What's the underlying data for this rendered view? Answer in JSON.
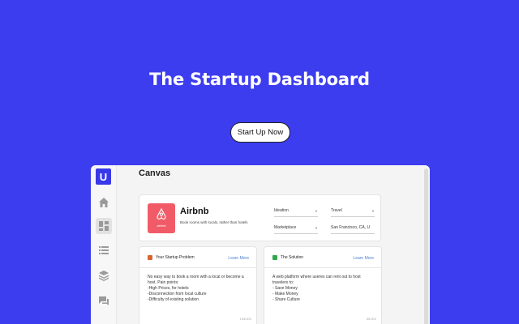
{
  "hero": {
    "title": "The Startup Dashboard",
    "cta_label": "Start Up Now"
  },
  "app": {
    "logo_letter": "U",
    "page_title": "Canvas",
    "sidebar": [
      {
        "icon": "home-icon"
      },
      {
        "icon": "dashboard-icon",
        "active": true
      },
      {
        "icon": "list-icon"
      },
      {
        "icon": "layers-icon"
      },
      {
        "icon": "chat-icon"
      }
    ],
    "startup": {
      "name": "Airbnb",
      "logo_text": "airbnb",
      "tagline": "Book rooms with locals, rather than hotels",
      "selects": [
        {
          "value": "Ideation",
          "chevron": true
        },
        {
          "value": "Travel",
          "chevron": true
        },
        {
          "value": "Marketplace",
          "chevron": true
        },
        {
          "value": "San Francisco, CA, U",
          "chevron": false
        }
      ]
    },
    "panels": [
      {
        "title": "Your Startup Problem",
        "icon": "x-box-icon",
        "icon_color": "#d9642f",
        "link": "Learn More",
        "lines": [
          "No easy way to book a room with a local or become a",
          "host. Pain points:",
          "-High Prices,  for hotels",
          "-Disconnection from local culture",
          "-Difficulty of existing solution"
        ],
        "count": "163/300"
      },
      {
        "title": "The Solution",
        "icon": "check-box-icon",
        "icon_color": "#2fa84f",
        "link": "Learn More",
        "lines": [
          "A web platform where useres can rent out to host",
          "travelers to:",
          "- Save Money",
          "- Make Money",
          "- Share Culture"
        ],
        "count": "85/300"
      }
    ]
  },
  "colors": {
    "background": "#3d3df0",
    "accent": "#3838e8",
    "brand": "#f15b67",
    "link": "#4a7fd4"
  }
}
